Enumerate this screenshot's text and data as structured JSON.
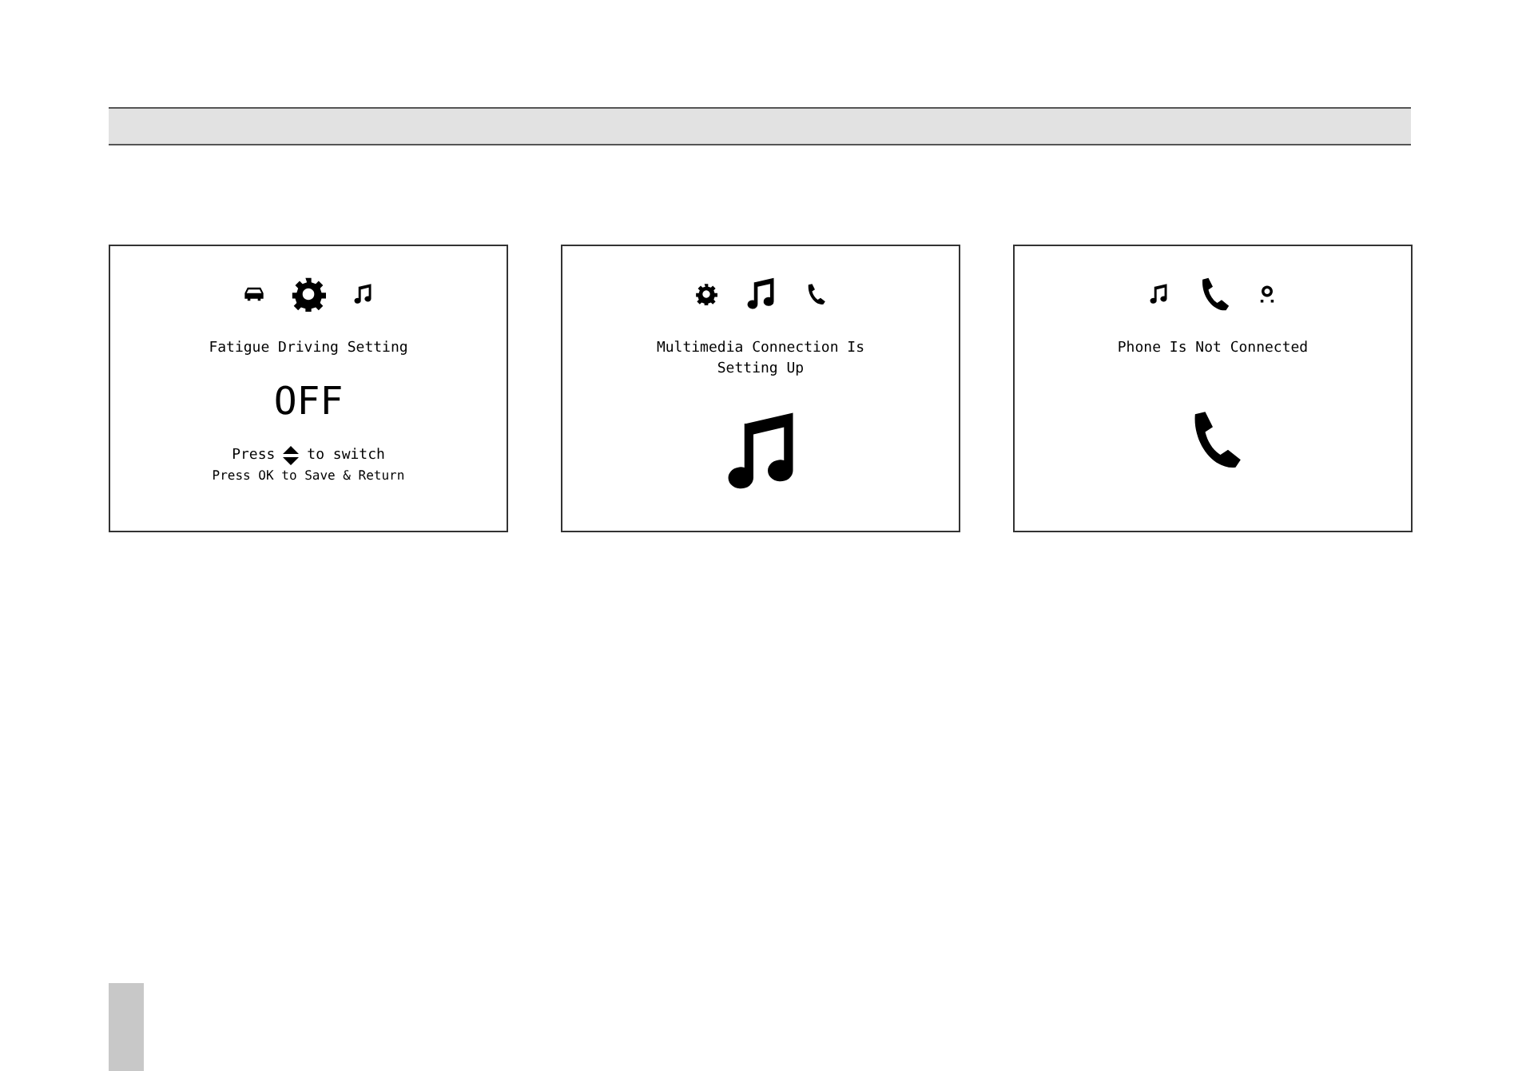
{
  "screens": [
    {
      "icons": [
        {
          "kind": "car",
          "selected": false
        },
        {
          "kind": "gear",
          "selected": true
        },
        {
          "kind": "music",
          "selected": false
        }
      ],
      "title_lines": [
        "Fatigue Driving Setting"
      ],
      "value": "OFF",
      "hint": {
        "before": "Press",
        "after": "to switch"
      },
      "footer": "Press OK to Save & Return"
    },
    {
      "icons": [
        {
          "kind": "gear",
          "selected": false
        },
        {
          "kind": "music",
          "selected": true
        },
        {
          "kind": "phone",
          "selected": false
        }
      ],
      "title_lines": [
        "Multimedia Connection Is",
        "Setting Up"
      ],
      "big_icon": {
        "kind": "music"
      }
    },
    {
      "icons": [
        {
          "kind": "music",
          "selected": false
        },
        {
          "kind": "phone",
          "selected": true
        },
        {
          "kind": "camera",
          "selected": false
        }
      ],
      "title_lines": [
        "Phone Is Not Connected"
      ],
      "big_icon": {
        "kind": "phone"
      }
    }
  ]
}
